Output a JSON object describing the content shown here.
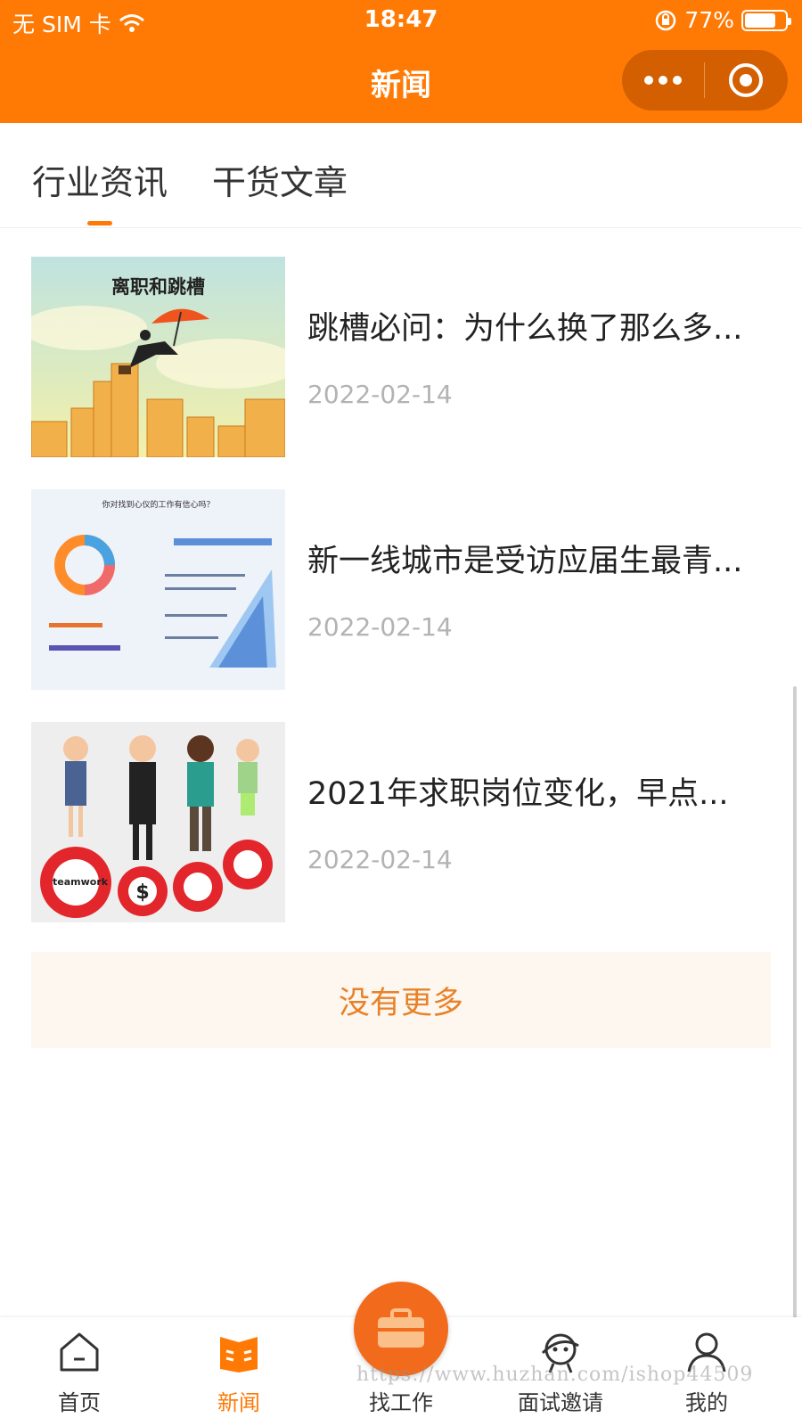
{
  "status_bar": {
    "carrier": "无 SIM 卡",
    "time": "18:47",
    "battery_text": "77%",
    "battery_level": 0.77,
    "icons": [
      "wifi-icon",
      "rotation-lock-icon",
      "battery-icon"
    ]
  },
  "header": {
    "title": "新闻",
    "accent_color": "#ff7a05",
    "capsule_icons": [
      "more-dots-icon",
      "close-circle-icon"
    ]
  },
  "tabs": [
    {
      "label": "行业资讯",
      "active": true
    },
    {
      "label": "干货文章",
      "active": false
    }
  ],
  "articles": [
    {
      "title": "跳槽必问：为什么换了那么多...",
      "date": "2022-02-14",
      "thumb_caption": "离职和跳槽"
    },
    {
      "title": "新一线城市是受访应届生最青...",
      "date": "2022-02-14",
      "thumb_caption": "你对找到心仪的工作有信心吗？"
    },
    {
      "title": "2021年求职岗位变化，早点...",
      "date": "2022-02-14",
      "thumb_caption": "teamwork"
    }
  ],
  "no_more_text": "没有更多",
  "tabbar": [
    {
      "label": "首页",
      "icon": "home-icon",
      "active": false
    },
    {
      "label": "新闻",
      "icon": "news-book-icon",
      "active": true
    },
    {
      "label": "找工作",
      "icon": "briefcase-icon",
      "active": false
    },
    {
      "label": "面试邀请",
      "icon": "astronaut-icon",
      "active": false
    },
    {
      "label": "我的",
      "icon": "user-icon",
      "active": false
    }
  ],
  "watermark": "https://www.huzhan.com/ishop44509"
}
